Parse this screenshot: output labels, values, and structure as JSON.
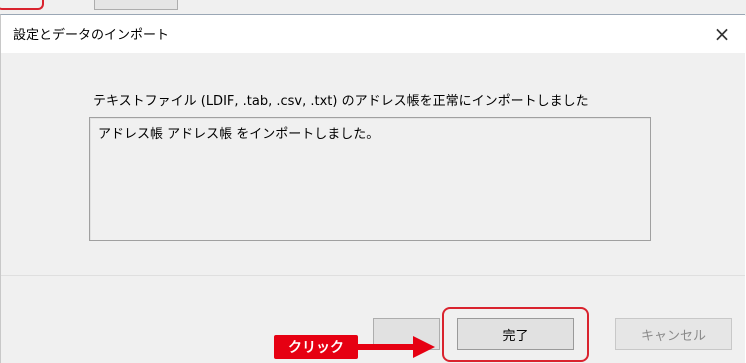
{
  "dialog": {
    "title": "設定とデータのインポート",
    "close_glyph": "×",
    "message": "テキストファイル (LDIF, .tab, .csv, .txt) のアドレス帳を正常にインポートしました",
    "result_text": "アドレス帳 アドレス帳 をインポートしました。"
  },
  "buttons": {
    "finish_label": "完了",
    "cancel_label": "キャンセル"
  },
  "annotation": {
    "click_label": "クリック",
    "color": "#e60012"
  }
}
